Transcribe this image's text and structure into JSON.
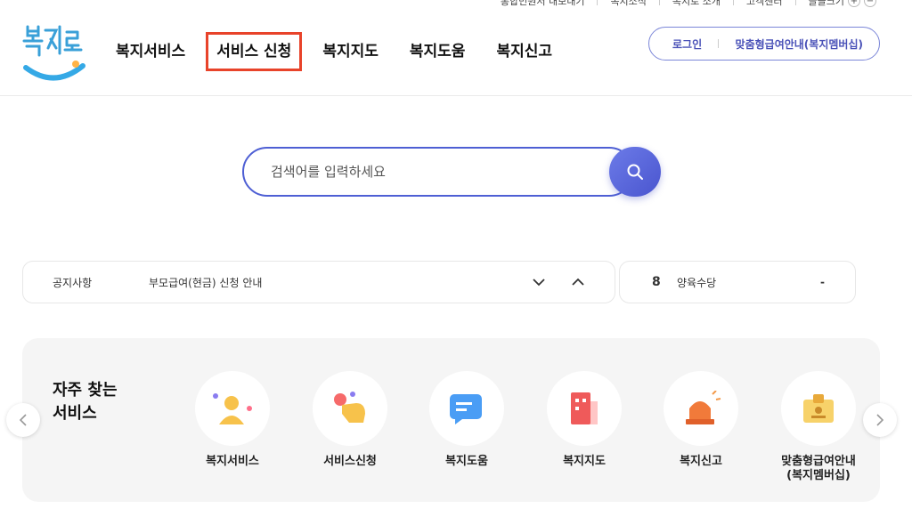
{
  "util": {
    "items": [
      "통합민원서 내보내기",
      "복지소식",
      "복지로 소개",
      "고객센터",
      "글꼴크기"
    ],
    "zoom_in": "+",
    "zoom_out": "−"
  },
  "header": {
    "logo_text": "복지로",
    "nav": [
      "복지서비스",
      "서비스 신청",
      "복지지도",
      "복지도움",
      "복지신고"
    ],
    "login": "로그인",
    "membership": "맞춤형급여안내(복지멤버십)"
  },
  "search": {
    "placeholder": "검색어를 입력하세요"
  },
  "notice": {
    "label": "공지사항",
    "text": "부모급여(현금) 신청 안내"
  },
  "rank": {
    "number": "8",
    "text": "양육수당",
    "change": "-"
  },
  "quick": {
    "title_line1": "자주 찾는",
    "title_line2": "서비스",
    "items": [
      {
        "label": "복지서비스",
        "icon": "person-icon"
      },
      {
        "label": "서비스신청",
        "icon": "hand-tap-icon"
      },
      {
        "label": "복지도움",
        "icon": "chat-icon"
      },
      {
        "label": "복지지도",
        "icon": "building-icon"
      },
      {
        "label": "복지신고",
        "icon": "siren-icon"
      },
      {
        "label": "맞춤형급여안내",
        "label2": "(복지멤버십)",
        "icon": "id-card-icon"
      }
    ]
  },
  "colors": {
    "accent": "#4e5fd4",
    "highlight": "#e8432a",
    "panel_bg": "#f5f5f5"
  }
}
